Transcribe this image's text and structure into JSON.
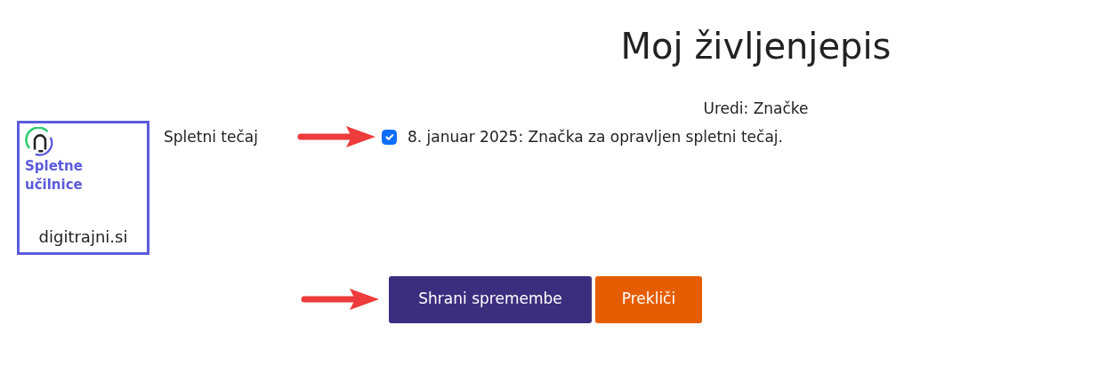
{
  "title": "Moj življenjepis",
  "section_heading": "Uredi: Značke",
  "badges": [
    {
      "logo": {
        "line_1": "Spletne",
        "line_2": "učilnice",
        "site": "digitrajni.si"
      },
      "course": "Spletni tečaj",
      "checked": true,
      "text": "8. januar 2025: Značka za opravljen spletni tečaj."
    }
  ],
  "buttons": [
    {
      "label": "Shrani spremembe",
      "kind": "primary"
    },
    {
      "label": "Prekliči",
      "kind": "cancel"
    }
  ]
}
